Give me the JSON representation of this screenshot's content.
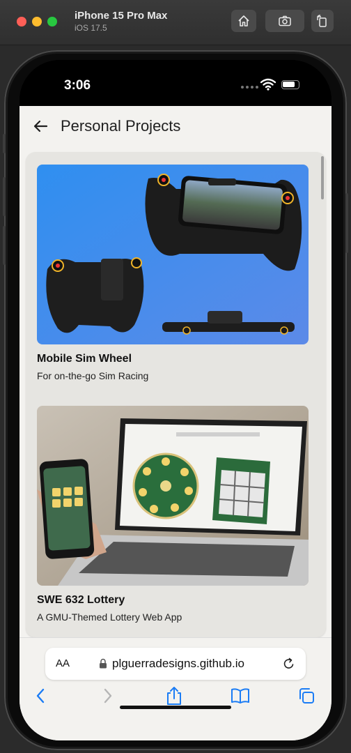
{
  "simulator": {
    "device_name": "iPhone 15 Pro Max",
    "os_version": "iOS 17.5",
    "toolbar_icons": [
      "home-icon",
      "screenshot-camera-icon",
      "rotate-icon"
    ]
  },
  "status_bar": {
    "time": "3:06"
  },
  "app": {
    "title": "Personal Projects",
    "background": "#f3f2ef",
    "projects": [
      {
        "title": "Mobile Sim Wheel",
        "description": "For on-the-go Sim Racing",
        "image_accent": "#3d8ef0"
      },
      {
        "title": "SWE 632 Lottery",
        "description": "A GMU-Themed Lottery Web App",
        "image_accent": "#1f6b3a"
      }
    ]
  },
  "browser": {
    "aa_label": "AA",
    "url": "plguerradesigns.github.io",
    "accent_color": "#1a7cf5",
    "toolbar_icons": [
      "back-icon",
      "forward-icon",
      "share-icon",
      "bookmarks-icon",
      "tabs-icon"
    ]
  }
}
